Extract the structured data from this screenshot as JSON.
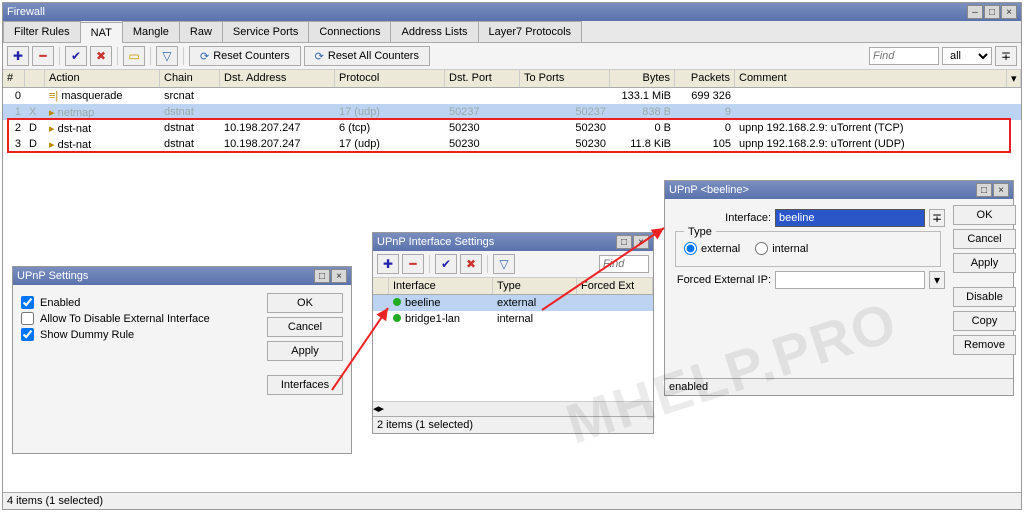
{
  "firewall": {
    "title": "Firewall",
    "tabs": [
      "Filter Rules",
      "NAT",
      "Mangle",
      "Raw",
      "Service Ports",
      "Connections",
      "Address Lists",
      "Layer7 Protocols"
    ],
    "activeTab": 1,
    "resetCounters": "Reset Counters",
    "resetAll": "Reset All Counters",
    "findPlaceholder": "Find",
    "filterAll": "all",
    "columns": {
      "num": "#",
      "action": "Action",
      "chain": "Chain",
      "dst": "Dst. Address",
      "proto": "Protocol",
      "dport": "Dst. Port",
      "tports": "To Ports",
      "bytes": "Bytes",
      "packets": "Packets",
      "comment": "Comment"
    },
    "rows": [
      {
        "num": "0",
        "flag": "",
        "icon": "≡|",
        "action": "masquerade",
        "chain": "srcnat",
        "dst": "",
        "proto": "",
        "dport": "",
        "tports": "",
        "bytes": "133.1 MiB",
        "packets": "699 326",
        "comment": "",
        "style": ""
      },
      {
        "num": "1",
        "flag": "X",
        "icon": "▸",
        "action": "netmap",
        "chain": "dstnat",
        "dst": "",
        "proto": "17 (udp)",
        "dport": "50237",
        "tports": "50237",
        "bytes": "838 B",
        "packets": "9",
        "comment": "",
        "style": "sel disabled"
      },
      {
        "num": "2",
        "flag": "D",
        "icon": "▸",
        "action": "dst-nat",
        "chain": "dstnat",
        "dst": "10.198.207.247",
        "proto": "6 (tcp)",
        "dport": "50230",
        "tports": "50230",
        "bytes": "0 B",
        "packets": "0",
        "comment": "upnp 192.168.2.9: uTorrent (TCP)",
        "style": ""
      },
      {
        "num": "3",
        "flag": "D",
        "icon": "▸",
        "action": "dst-nat",
        "chain": "dstnat",
        "dst": "10.198.207.247",
        "proto": "17 (udp)",
        "dport": "50230",
        "tports": "50230",
        "bytes": "11.8 KiB",
        "packets": "105",
        "comment": "upnp 192.168.2.9: uTorrent (UDP)",
        "style": ""
      }
    ],
    "status": "4 items (1 selected)"
  },
  "upnpSettings": {
    "title": "UPnP Settings",
    "enabled": "Enabled",
    "allowDisable": "Allow To Disable External Interface",
    "showDummy": "Show Dummy Rule",
    "ok": "OK",
    "cancel": "Cancel",
    "apply": "Apply",
    "interfaces": "Interfaces"
  },
  "upnpIf": {
    "title": "UPnP Interface Settings",
    "find": "Find",
    "cols": {
      "iface": "Interface",
      "type": "Type",
      "forced": "Forced Ext"
    },
    "rows": [
      {
        "name": "beeline",
        "type": "external",
        "sel": true
      },
      {
        "name": "bridge1-lan",
        "type": "internal",
        "sel": false
      }
    ],
    "status": "2 items (1 selected)"
  },
  "upnpBeeline": {
    "title": "UPnP <beeline>",
    "ifaceLabel": "Interface:",
    "iface": "beeline",
    "typeLabel": "Type",
    "external": "external",
    "internal": "internal",
    "forcedLabel": "Forced External IP:",
    "ok": "OK",
    "cancel": "Cancel",
    "apply": "Apply",
    "disable": "Disable",
    "copy": "Copy",
    "remove": "Remove",
    "status": "enabled"
  },
  "watermark": "MHELP.PRO"
}
